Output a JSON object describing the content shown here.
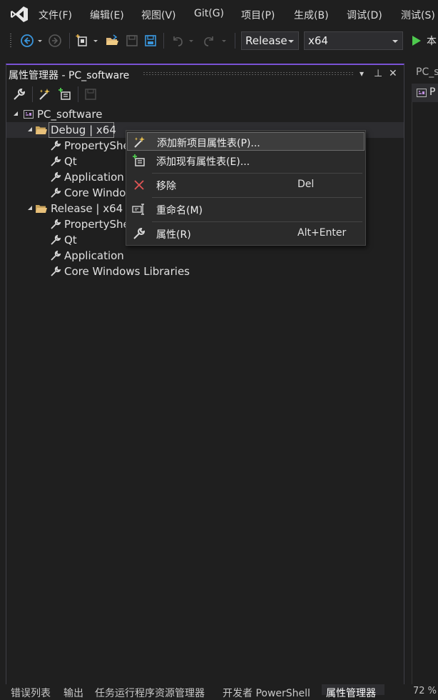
{
  "menu": [
    "文件(F)",
    "编辑(E)",
    "视图(V)",
    "Git(G)",
    "项目(P)",
    "生成(B)",
    "调试(D)",
    "测试(S)"
  ],
  "toolbar": {
    "configuration": "Release",
    "platform": "x64",
    "run_label": "本"
  },
  "panel": {
    "title": "属性管理器 - PC_software",
    "dropdown_glyph": "▾",
    "pin_glyph": "⊥",
    "close_glyph": "✕"
  },
  "tree": {
    "project": "PC_software",
    "debug_group": "Debug | x64",
    "debug_items": [
      "PropertySheet",
      "Qt",
      "Application",
      "Core Windows Libraries"
    ],
    "release_group": "Release | x64",
    "release_items": [
      "PropertySheet",
      "Qt",
      "Application",
      "Core Windows Libraries"
    ]
  },
  "context_menu": {
    "add_new": "添加新项目属性表(P)...",
    "add_existing": "添加现有属性表(E)...",
    "remove": "移除",
    "remove_shortcut": "Del",
    "rename": "重命名(M)",
    "properties": "属性(R)",
    "properties_shortcut": "Alt+Enter"
  },
  "doc": {
    "tab_label": "PC_s",
    "strip_label": "P",
    "zoom": "72 %"
  },
  "bottom_tabs": [
    "错误列表",
    "输出",
    "任务运行程序资源管理器",
    "开发者 PowerShell",
    "属性管理器"
  ]
}
